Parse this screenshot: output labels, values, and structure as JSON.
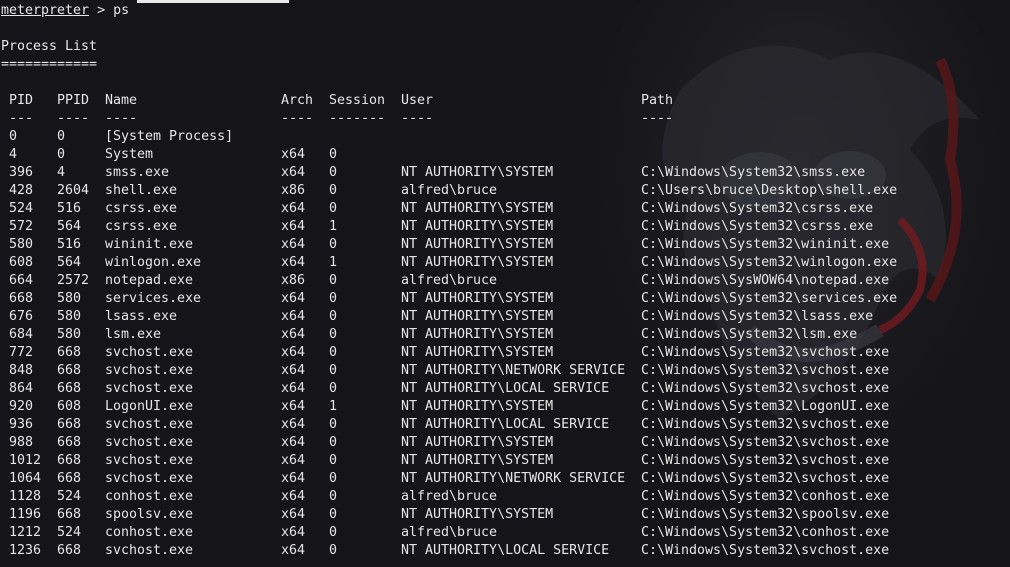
{
  "terminal": {
    "prompt": "meterpreter",
    "prompt_sep": " > ",
    "command": "ps",
    "heading": "Process List",
    "heading_rule": "============"
  },
  "table": {
    "headers": [
      "PID",
      "PPID",
      "Name",
      "Arch",
      "Session",
      "User",
      "Path"
    ],
    "underlines": [
      "---",
      "----",
      "----",
      "----",
      "-------",
      "----",
      "----"
    ],
    "rows": [
      [
        "0",
        "0",
        "[System Process]",
        "",
        "",
        "",
        ""
      ],
      [
        "4",
        "0",
        "System",
        "x64",
        "0",
        "",
        ""
      ],
      [
        "396",
        "4",
        "smss.exe",
        "x64",
        "0",
        "NT AUTHORITY\\SYSTEM",
        "C:\\Windows\\System32\\smss.exe"
      ],
      [
        "428",
        "2604",
        "shell.exe",
        "x86",
        "0",
        "alfred\\bruce",
        "C:\\Users\\bruce\\Desktop\\shell.exe"
      ],
      [
        "524",
        "516",
        "csrss.exe",
        "x64",
        "0",
        "NT AUTHORITY\\SYSTEM",
        "C:\\Windows\\System32\\csrss.exe"
      ],
      [
        "572",
        "564",
        "csrss.exe",
        "x64",
        "1",
        "NT AUTHORITY\\SYSTEM",
        "C:\\Windows\\System32\\csrss.exe"
      ],
      [
        "580",
        "516",
        "wininit.exe",
        "x64",
        "0",
        "NT AUTHORITY\\SYSTEM",
        "C:\\Windows\\System32\\wininit.exe"
      ],
      [
        "608",
        "564",
        "winlogon.exe",
        "x64",
        "1",
        "NT AUTHORITY\\SYSTEM",
        "C:\\Windows\\System32\\winlogon.exe"
      ],
      [
        "664",
        "2572",
        "notepad.exe",
        "x86",
        "0",
        "alfred\\bruce",
        "C:\\Windows\\SysWOW64\\notepad.exe"
      ],
      [
        "668",
        "580",
        "services.exe",
        "x64",
        "0",
        "NT AUTHORITY\\SYSTEM",
        "C:\\Windows\\System32\\services.exe"
      ],
      [
        "676",
        "580",
        "lsass.exe",
        "x64",
        "0",
        "NT AUTHORITY\\SYSTEM",
        "C:\\Windows\\System32\\lsass.exe"
      ],
      [
        "684",
        "580",
        "lsm.exe",
        "x64",
        "0",
        "NT AUTHORITY\\SYSTEM",
        "C:\\Windows\\System32\\lsm.exe"
      ],
      [
        "772",
        "668",
        "svchost.exe",
        "x64",
        "0",
        "NT AUTHORITY\\SYSTEM",
        "C:\\Windows\\System32\\svchost.exe"
      ],
      [
        "848",
        "668",
        "svchost.exe",
        "x64",
        "0",
        "NT AUTHORITY\\NETWORK SERVICE",
        "C:\\Windows\\System32\\svchost.exe"
      ],
      [
        "864",
        "668",
        "svchost.exe",
        "x64",
        "0",
        "NT AUTHORITY\\LOCAL SERVICE",
        "C:\\Windows\\System32\\svchost.exe"
      ],
      [
        "920",
        "608",
        "LogonUI.exe",
        "x64",
        "1",
        "NT AUTHORITY\\SYSTEM",
        "C:\\Windows\\System32\\LogonUI.exe"
      ],
      [
        "936",
        "668",
        "svchost.exe",
        "x64",
        "0",
        "NT AUTHORITY\\LOCAL SERVICE",
        "C:\\Windows\\System32\\svchost.exe"
      ],
      [
        "988",
        "668",
        "svchost.exe",
        "x64",
        "0",
        "NT AUTHORITY\\SYSTEM",
        "C:\\Windows\\System32\\svchost.exe"
      ],
      [
        "1012",
        "668",
        "svchost.exe",
        "x64",
        "0",
        "NT AUTHORITY\\SYSTEM",
        "C:\\Windows\\System32\\svchost.exe"
      ],
      [
        "1064",
        "668",
        "svchost.exe",
        "x64",
        "0",
        "NT AUTHORITY\\NETWORK SERVICE",
        "C:\\Windows\\System32\\svchost.exe"
      ],
      [
        "1128",
        "524",
        "conhost.exe",
        "x64",
        "0",
        "alfred\\bruce",
        "C:\\Windows\\System32\\conhost.exe"
      ],
      [
        "1196",
        "668",
        "spoolsv.exe",
        "x64",
        "0",
        "NT AUTHORITY\\SYSTEM",
        "C:\\Windows\\System32\\spoolsv.exe"
      ],
      [
        "1212",
        "524",
        "conhost.exe",
        "x64",
        "0",
        "alfred\\bruce",
        "C:\\Windows\\System32\\conhost.exe"
      ],
      [
        "1236",
        "668",
        "svchost.exe",
        "x64",
        "0",
        "NT AUTHORITY\\LOCAL SERVICE",
        "C:\\Windows\\System32\\svchost.exe"
      ]
    ]
  },
  "colors": {
    "background": "#151519",
    "text": "#e6e6e6"
  }
}
